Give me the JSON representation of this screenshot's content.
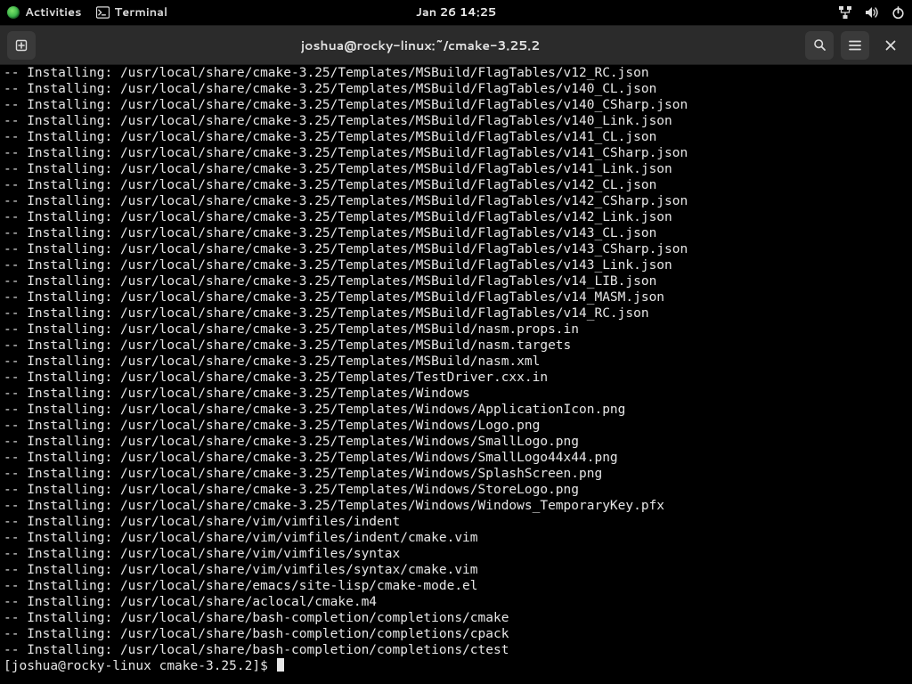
{
  "topbar": {
    "activities_label": "Activities",
    "terminal_label": "Terminal",
    "clock": "Jan 26  14:25"
  },
  "window": {
    "title": "joshua@rocky-linux:~/cmake-3.25.2"
  },
  "terminal": {
    "prefix": "-- Installing: ",
    "base_path": "/usr/local/share/cmake-3.25/Templates/MSBuild/FlagTables/",
    "files_flagtables": [
      "v12_RC.json",
      "v140_CL.json",
      "v140_CSharp.json",
      "v140_Link.json",
      "v141_CL.json",
      "v141_CSharp.json",
      "v141_Link.json",
      "v142_CL.json",
      "v142_CSharp.json",
      "v142_Link.json",
      "v143_CL.json",
      "v143_CSharp.json",
      "v143_Link.json",
      "v14_LIB.json",
      "v14_MASM.json",
      "v14_RC.json"
    ],
    "lines_after": [
      "/usr/local/share/cmake-3.25/Templates/MSBuild/nasm.props.in",
      "/usr/local/share/cmake-3.25/Templates/MSBuild/nasm.targets",
      "/usr/local/share/cmake-3.25/Templates/MSBuild/nasm.xml",
      "/usr/local/share/cmake-3.25/Templates/TestDriver.cxx.in",
      "/usr/local/share/cmake-3.25/Templates/Windows",
      "/usr/local/share/cmake-3.25/Templates/Windows/ApplicationIcon.png",
      "/usr/local/share/cmake-3.25/Templates/Windows/Logo.png",
      "/usr/local/share/cmake-3.25/Templates/Windows/SmallLogo.png",
      "/usr/local/share/cmake-3.25/Templates/Windows/SmallLogo44x44.png",
      "/usr/local/share/cmake-3.25/Templates/Windows/SplashScreen.png",
      "/usr/local/share/cmake-3.25/Templates/Windows/StoreLogo.png",
      "/usr/local/share/cmake-3.25/Templates/Windows/Windows_TemporaryKey.pfx",
      "/usr/local/share/vim/vimfiles/indent",
      "/usr/local/share/vim/vimfiles/indent/cmake.vim",
      "/usr/local/share/vim/vimfiles/syntax",
      "/usr/local/share/vim/vimfiles/syntax/cmake.vim",
      "/usr/local/share/emacs/site-lisp/cmake-mode.el",
      "/usr/local/share/aclocal/cmake.m4",
      "/usr/local/share/bash-completion/completions/cmake",
      "/usr/local/share/bash-completion/completions/cpack",
      "/usr/local/share/bash-completion/completions/ctest"
    ],
    "prompt_user": "joshua",
    "prompt_host": "rocky-linux",
    "prompt_cwd": "cmake-3.25.2"
  }
}
